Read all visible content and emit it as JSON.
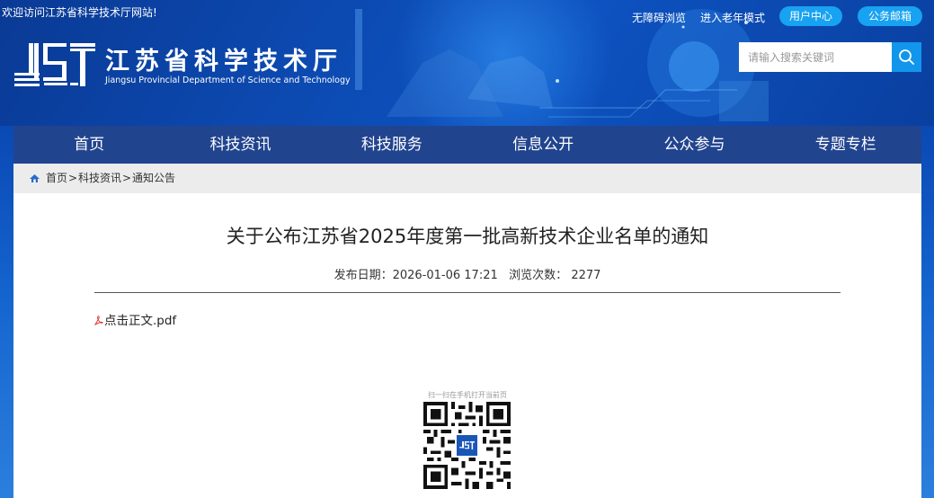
{
  "header": {
    "welcome": "欢迎访问江苏省科学技术厅网站!",
    "links": {
      "accessible": "无障碍浏览",
      "elder_mode": "进入老年模式",
      "user_center": "用户中心",
      "public_mail": "公务邮箱"
    },
    "logo": {
      "cn": "江苏省科学技术厅",
      "en": "Jiangsu Provincial Department of Science and Technology"
    },
    "search": {
      "placeholder": "请输入搜索关键词",
      "icon": "search-icon"
    }
  },
  "nav": {
    "items": [
      "首页",
      "科技资讯",
      "科技服务",
      "信息公开",
      "公众参与",
      "专题专栏"
    ]
  },
  "breadcrumb": {
    "home": "首页",
    "news": "科技资讯",
    "notice": "通知公告",
    "sep": ">"
  },
  "article": {
    "title": "关于公布江苏省2025年度第一批高新技术企业名单的通知",
    "date_label": "发布日期：",
    "date": "2026-01-06 17:21",
    "views_label": "浏览次数：",
    "views": "2277",
    "attachment": "点击正文.pdf",
    "qr_caption": "扫一扫在手机打开当前页"
  },
  "colors": {
    "nav_bg": "#21448f",
    "button_bg": "#17a2f2",
    "search_btn": "#1296ec"
  }
}
